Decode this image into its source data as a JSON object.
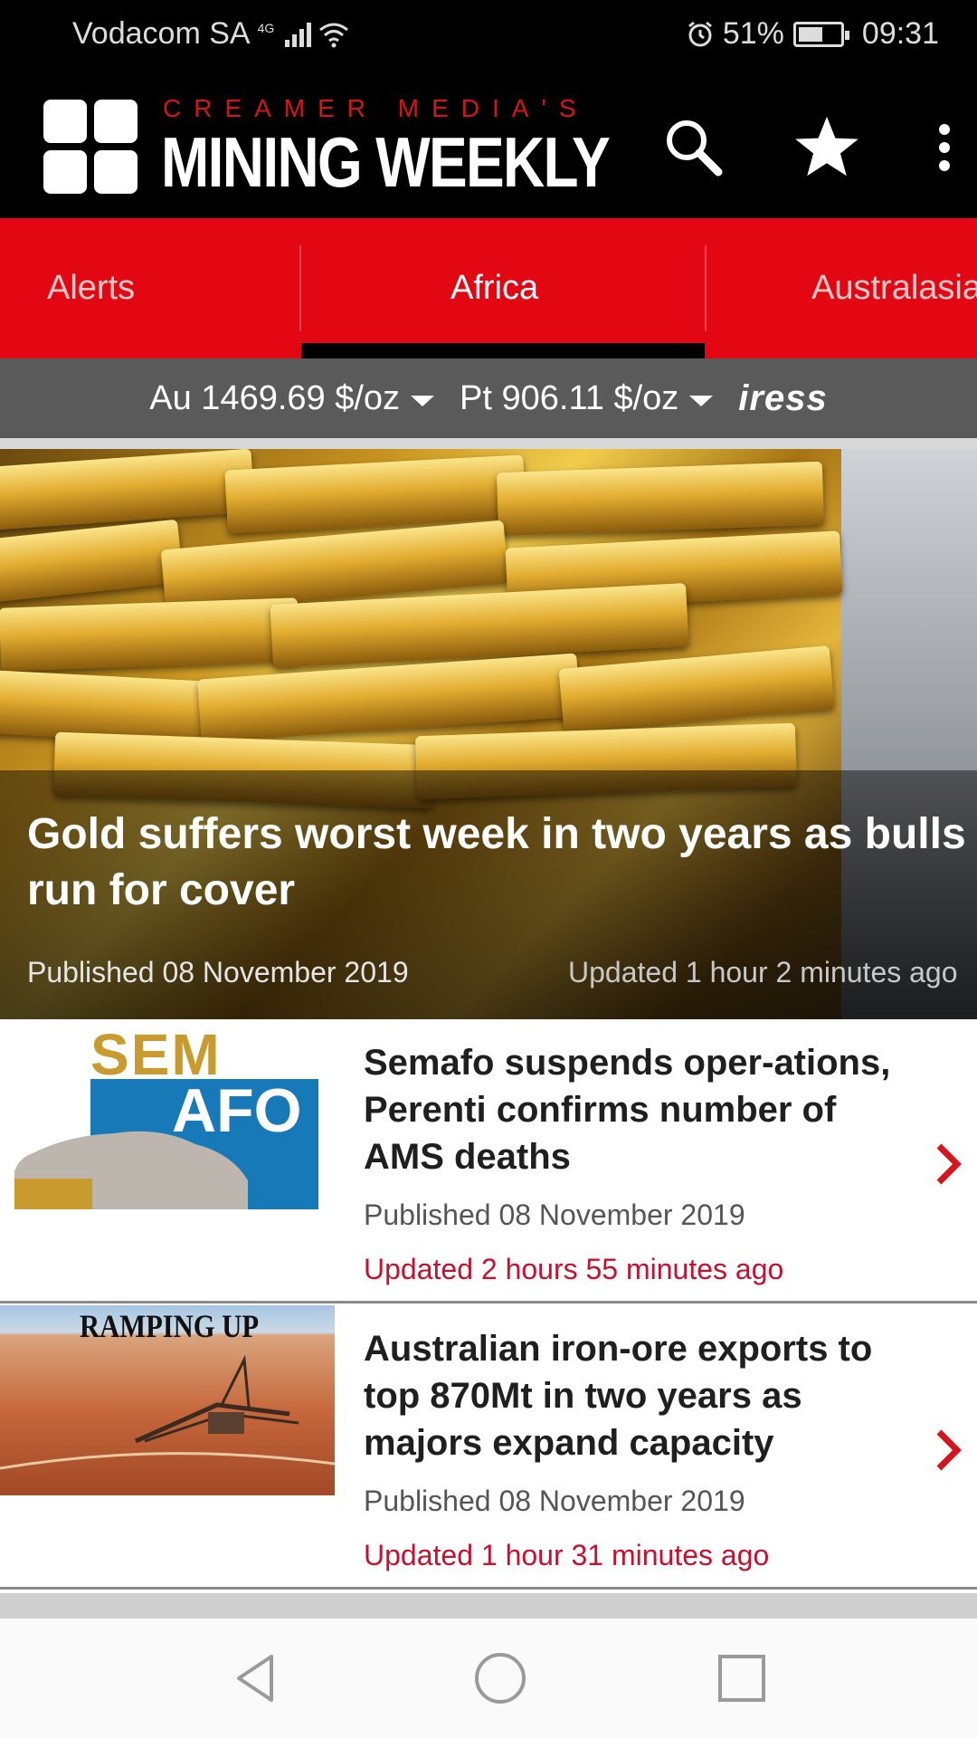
{
  "status": {
    "carrier": "Vodacom SA",
    "network": "4G",
    "battery": "51%",
    "time": "09:31"
  },
  "header": {
    "brand_top": "CREAMER MEDIA'S",
    "brand_main": "MINING WEEKLY",
    "icons": [
      "search-icon",
      "star-icon",
      "more-vert-icon"
    ]
  },
  "tabs": [
    {
      "label": "Alerts",
      "active": false
    },
    {
      "label": "Africa",
      "active": true
    },
    {
      "label": "Australasia",
      "active": false
    }
  ],
  "ticker": {
    "au": "Au 1469.69 $/oz",
    "pt": "Pt 906.11 $/oz",
    "provider": "iress"
  },
  "hero": {
    "title": "Gold suffers worst week in two years as bulls run for cover",
    "published": "Published 08 November 2019",
    "updated": "Updated 1 hour 2 minutes ago"
  },
  "articles": [
    {
      "title": "Semafo suspends oper-ations, Perenti confirms number of AMS deaths",
      "published": "Published 08 November 2019",
      "updated": "Updated 2 hours 55 minutes ago",
      "thumb_top": "SEM",
      "thumb_bottom": "AFO"
    },
    {
      "title": "Australian iron-ore exports to top 870Mt in two years as majors expand capacity",
      "published": "Published 08 November 2019",
      "updated": "Updated 1 hour 31 minutes ago",
      "thumb_label": "RAMPING UP"
    }
  ],
  "colors": {
    "accent_red": "#e30613",
    "updated_red": "#c8102e",
    "header_black": "#000000",
    "ticker_gray": "#5a5a5a"
  }
}
